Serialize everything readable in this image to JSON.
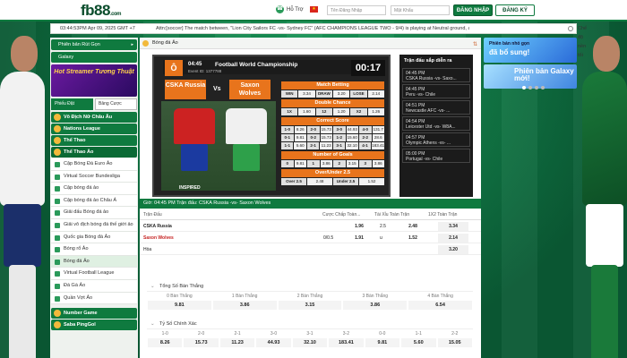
{
  "header": {
    "logo": "fb88",
    "logo_suffix": ".com",
    "support_label": "Hỗ Trợ",
    "flag": "★",
    "username_placeholder": "Tên Đăng Nhập",
    "password_placeholder": "Mật Khẩu",
    "login_label": "ĐĂNG NHẬP",
    "register_label": "ĐĂNG KÝ"
  },
  "infobar": {
    "time": "03:44:53PM Apr 09, 2025 GMT +7",
    "ticker": "Attn:[soccer] The match between, \"Lion City Sailors FC -vs- Sydney FC\" (AFC CHAMPIONS LEAGUE TWO - 9/4) is playing at Neutral ground, all bets taken are",
    "toggle_label": "Chế độ nền tối"
  },
  "sidebar": {
    "tab1": "Phiên bản Rút Gọn",
    "tab2": "Galaxy",
    "banner": "Hot Streamer Tương Thuật",
    "filter_active": "Phiếu Đặt",
    "filter_other": "Bảng Cược",
    "sections": [
      {
        "label": "Võ Địch Nữ Châu Âu"
      },
      {
        "label": "Nations League"
      },
      {
        "label": "Thể Thao"
      },
      {
        "label": "Thể Thao Ảo"
      }
    ],
    "items": [
      {
        "label": "Cập Bóng Đá Euro Ảo"
      },
      {
        "label": "Virtual Soccer Bundesliga"
      },
      {
        "label": "Cập bóng đá ảo"
      },
      {
        "label": "Cập bóng đá ảo Châu Á"
      },
      {
        "label": "Giải đấu Bóng đá ảo"
      },
      {
        "label": "Giải vô địch bóng đá thế giới ảo"
      },
      {
        "label": "Quốc gia Bóng đá Ảo"
      },
      {
        "label": "Bóng rổ Ảo"
      },
      {
        "label": "Bóng đá Ảo"
      },
      {
        "label": "Virtual Football League"
      },
      {
        "label": "Đá Gà Ảo"
      },
      {
        "label": "Quần Vợt Ảo"
      }
    ],
    "bottom1": "Number Game",
    "bottom2": "Saba PingGol"
  },
  "panel": {
    "title": "Bóng đá Ảo"
  },
  "video": {
    "badge": "Ô",
    "time": "04:45",
    "event_id": "Event ID: 1377788",
    "title": "Football World Championship",
    "clock": "00:17",
    "team1": "CSKA Russia",
    "team2": "Saxon Wolves",
    "vs": "Vs",
    "inspired": "INSPIRED",
    "match_betting_hdr": "Match Betting",
    "match_betting": [
      "WIN",
      "3.34",
      "DRAW",
      "3.20",
      "LOSE",
      "2.14"
    ],
    "double_chance_hdr": "Double Chance",
    "double_chance": [
      "1X",
      "1.60",
      "12",
      "1.20",
      "X2",
      "1.26"
    ],
    "correct_score_hdr": "Correct Score",
    "correct_rows": [
      [
        "1-0",
        "8.26",
        "2-0",
        "15.73",
        "3-0",
        "44.93",
        "4-0",
        "131.7"
      ],
      [
        "0-1",
        "9.81",
        "0-2",
        "15.73",
        "1-2",
        "15.60",
        "2-2",
        "28.6"
      ],
      [
        "1-1",
        "5.60",
        "2-1",
        "11.23",
        "3-1",
        "32.10",
        "4-1",
        "183.41"
      ]
    ],
    "goals_hdr": "Number of Goals",
    "goals": [
      "0",
      "9.81",
      "1",
      "3.86",
      "2",
      "3.15",
      "3",
      "3.86"
    ],
    "ou_hdr": "Over/Under 2.5",
    "ou": [
      "Over 2.5",
      "2.48",
      "Under 2.5",
      "1.52"
    ]
  },
  "results": {
    "title": "Trận đấu sắp diễn ra",
    "items": [
      {
        "time": "04:45 PM",
        "match": "CSKA Russia -vs- Saxo..."
      },
      {
        "time": "04:45 PM",
        "match": "Peru -vs- Chile"
      },
      {
        "time": "04:51 PM",
        "match": "Newcastle AFC -vs- ..."
      },
      {
        "time": "04:54 PM",
        "match": "Leicester Utd -vs- W8A..."
      },
      {
        "time": "04:57 PM",
        "match": "Olympic Athens -vs- ..."
      },
      {
        "time": "05:00 PM",
        "match": "Portugal -vs- Chile"
      }
    ]
  },
  "match_bar": "Giờ: 04:45 PM   Trận đấu: CSKA Russia -vs- Saxon Wolves",
  "table": {
    "col_match": "Trận Đấu",
    "col_handicap": "Cược Chấp Toàn...",
    "col_ou": "Tài Xỉu Toàn Trận",
    "col_1x2": "1X2 Toàn Trận",
    "rows": [
      {
        "name": "CSKA Russia",
        "hcap": "",
        "hodd": "1.96",
        "ou": "2.5",
        "ouodd": "2.48",
        "x12": "3.34"
      },
      {
        "name": "Saxon Wolves",
        "hcap": "0/0.5",
        "hodd": "1.91",
        "ou": "u",
        "ouodd": "1.52",
        "x12": "2.14"
      },
      {
        "name": "Hòa",
        "hcap": "",
        "hodd": "",
        "ou": "",
        "ouodd": "",
        "x12": "3.20"
      }
    ]
  },
  "total_goals": {
    "title": "Tổng Số Bàn Thắng",
    "labels": [
      "0 Bàn Thắng",
      "1 Bàn Thắng",
      "2 Bàn Thắng",
      "3 Bàn Thắng",
      "4 Bàn Thắng"
    ],
    "values": [
      "9.81",
      "3.86",
      "3.15",
      "3.86",
      "6.54"
    ]
  },
  "exact_score": {
    "title": "Tỷ Số Chính Xác",
    "labels": [
      "1-0",
      "2-0",
      "2-1",
      "3-0",
      "3-1",
      "3-2",
      "0-0",
      "1-1",
      "2-2"
    ],
    "values": [
      "8.26",
      "15.73",
      "11.23",
      "44.93",
      "32.10",
      "183.41",
      "9.81",
      "5.60",
      "15.05"
    ]
  },
  "right_banners": {
    "b1_title": "Phiên bản nhỏ gọn",
    "b1_big": "đã bổ sung!",
    "b2_title": "Phiên bản Galaxy mới!"
  }
}
